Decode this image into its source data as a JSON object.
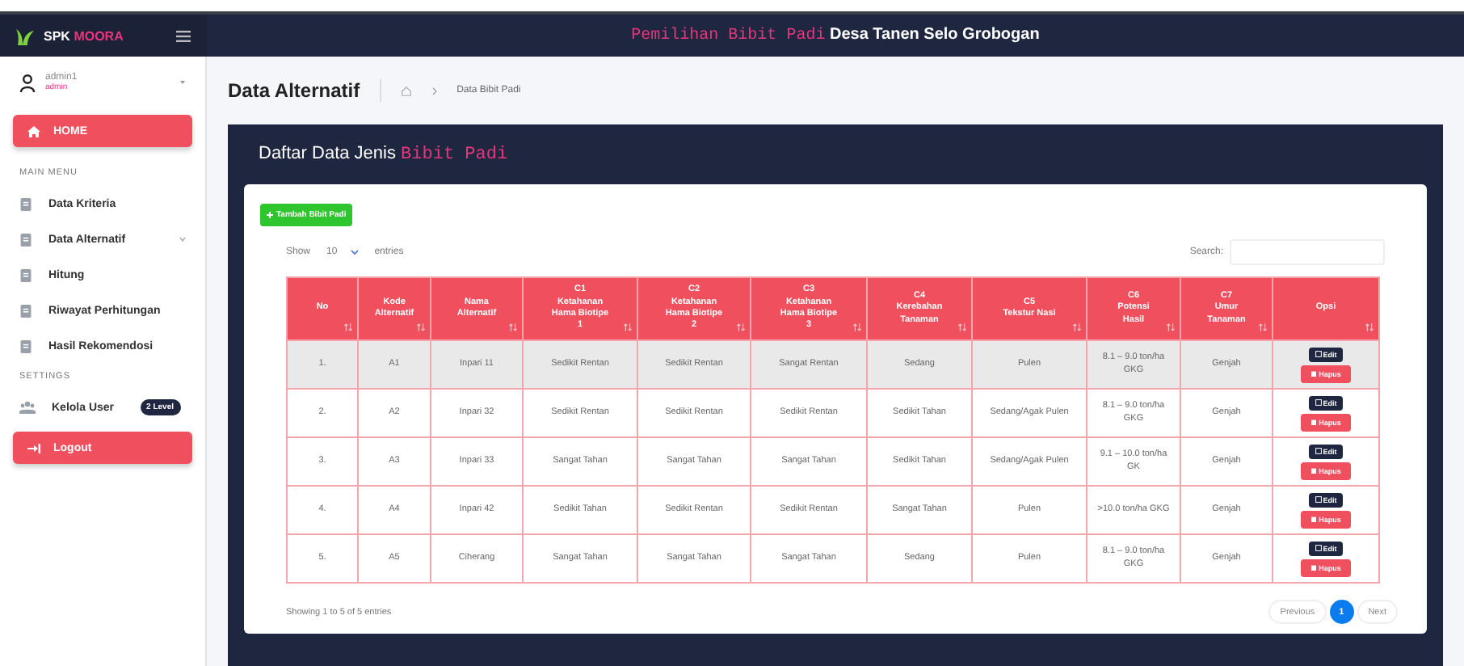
{
  "brand": {
    "prefix": "SPK",
    "highlight": "MOORA"
  },
  "header": {
    "highlight": "Pemilihan Bibit Padi",
    "title": "Desa Tanen Selo Grobogan"
  },
  "user": {
    "name": "admin1",
    "role": "admin"
  },
  "sidebar": {
    "items": [
      {
        "kind": "button",
        "label": "HOME"
      },
      {
        "kind": "heading",
        "label": "MAIN MENU"
      },
      {
        "kind": "link",
        "label": "Data Kriteria",
        "submenu": false
      },
      {
        "kind": "link",
        "label": "Data Alternatif",
        "submenu": true
      },
      {
        "kind": "link",
        "label": "Hitung",
        "submenu": false
      },
      {
        "kind": "link",
        "label": "Riwayat Perhitungan",
        "submenu": false
      },
      {
        "kind": "link",
        "label": "Hasil Rekomendosi",
        "submenu": false
      },
      {
        "kind": "heading",
        "label": "SETTINGS"
      },
      {
        "kind": "users",
        "label": "Kelola User",
        "badge": "2 Level"
      },
      {
        "kind": "button",
        "label": "Logout"
      }
    ]
  },
  "page": {
    "title": "Data Alternatif",
    "breadcrumb": "Data Bibit Padi"
  },
  "card": {
    "title": "Daftar Data Jenis",
    "highlight": "Bibit Padi"
  },
  "add_button": "Tambah Bibit Padi",
  "length": {
    "label": "Show",
    "value": "10",
    "suffix": "entries"
  },
  "search": {
    "label": "Search:"
  },
  "table": {
    "columns": [
      "No",
      "Kode\nAlternatif",
      "Nama\nAlternatif",
      "C1\nKetahanan\nHama Biotipe\n1",
      "C2\nKetahanan\nHama Biotipe\n2",
      "C3\nKetahanan\nHama Biotipe\n3",
      "C4\nKerebahan\nTanaman",
      "C5\nTekstur Nasi",
      "C6\nPotensi\nHasil",
      "C7\nUmur\nTanaman",
      "Opsi"
    ],
    "rows": [
      {
        "highlighted": true,
        "cells": [
          "1.",
          "A1",
          "Inpari 11",
          "Sedikit Rentan",
          "Sedikit Rentan",
          "Sangat Rentan",
          "Sedang",
          "Pulen",
          "8.1 – 9.0 ton/ha GKG",
          "Genjah"
        ],
        "actions": [
          "Edit",
          "Hapus"
        ]
      },
      {
        "highlighted": false,
        "cells": [
          "2.",
          "A2",
          "Inpari 32",
          "Sedikit Rentan",
          "Sedikit Rentan",
          "Sedikit Rentan",
          "Sedikit Tahan",
          "Sedang/Agak Pulen",
          "8.1 – 9.0 ton/ha GKG",
          "Genjah"
        ],
        "actions": [
          "Edit",
          "Hapus"
        ]
      },
      {
        "highlighted": false,
        "cells": [
          "3.",
          "A3",
          "Inpari 33",
          "Sangat Tahan",
          "Sangat Tahan",
          "Sangat Tahan",
          "Sedikit Tahan",
          "Sedang/Agak Pulen",
          "9.1 – 10.0 ton/ha GK",
          "Genjah"
        ],
        "actions": [
          "Edit",
          "Hapus"
        ]
      },
      {
        "highlighted": false,
        "cells": [
          "4.",
          "A4",
          "Inpari 42",
          "Sedikit Tahan",
          "Sedikit Rentan",
          "Sedikit Rentan",
          "Sangat Tahan",
          "Pulen",
          ">10.0 ton/ha GKG",
          "Genjah"
        ],
        "actions": [
          "Edit",
          "Hapus"
        ]
      },
      {
        "highlighted": false,
        "cells": [
          "5.",
          "A5",
          "Ciherang",
          "Sangat Tahan",
          "Sangat Tahan",
          "Sangat Tahan",
          "Sedang",
          "Pulen",
          "8.1 – 9.0 ton/ha GKG",
          "Genjah"
        ],
        "actions": [
          "Edit",
          "Hapus"
        ]
      }
    ]
  },
  "info": "Showing 1 to 5 of 5 entries",
  "pagination": [
    {
      "label": "Previous",
      "selected": false
    },
    {
      "label": "1",
      "selected": true
    },
    {
      "label": "Next",
      "selected": false
    }
  ]
}
